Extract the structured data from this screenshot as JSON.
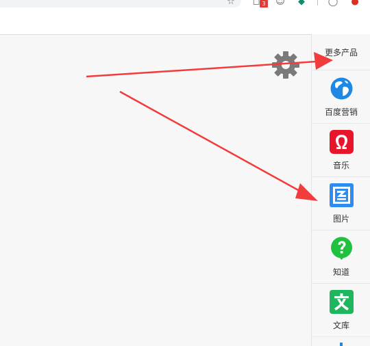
{
  "toolbar": {
    "extension_badge_count": "3",
    "icons": [
      "star-icon",
      "extension-icon",
      "emoji-icon",
      "vpn-icon",
      "profile-icon",
      "update-icon"
    ]
  },
  "settings": {
    "icon": "gear-icon"
  },
  "sidebar": {
    "more_label": "更多产品",
    "items": [
      {
        "label": "百度营销",
        "icon": "globe-icon",
        "color": "#1e88e5"
      },
      {
        "label": "音乐",
        "icon": "music-omega-icon",
        "color": "#e8162b"
      },
      {
        "label": "图片",
        "icon": "image-icon",
        "color": "#2e8bf0"
      },
      {
        "label": "知道",
        "icon": "question-icon",
        "color": "#1fc13f"
      },
      {
        "label": "文库",
        "icon": "wenku-icon",
        "color": "#20b65d"
      }
    ]
  },
  "annotations": {
    "arrow_color": "#f23b3b"
  }
}
